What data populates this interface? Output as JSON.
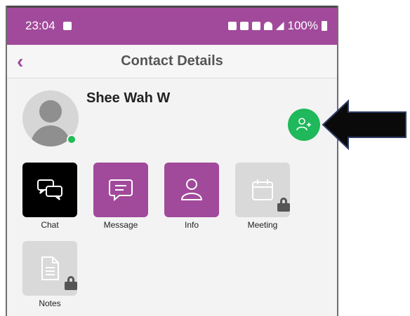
{
  "status_bar": {
    "time": "23:04",
    "battery": "100%",
    "icons": [
      "photo-icon",
      "nfc-icon",
      "vibrate-icon",
      "mute-icon",
      "wifi-icon",
      "signal-icon",
      "battery-icon"
    ]
  },
  "app_bar": {
    "title": "Contact Details",
    "back_icon": "chevron-left-icon"
  },
  "contact": {
    "name": "Shee Wah W",
    "presence": "online"
  },
  "actions": [
    {
      "label": "Chat",
      "enabled": true,
      "color": "#000000"
    },
    {
      "label": "Message",
      "enabled": true,
      "color": "#a14a9b"
    },
    {
      "label": "Info",
      "enabled": true,
      "color": "#a14a9b"
    },
    {
      "label": "Meeting",
      "enabled": false,
      "color": "#d9d9d9"
    },
    {
      "label": "Notes",
      "enabled": false,
      "color": "#d9d9d9"
    }
  ],
  "colors": {
    "brand": "#a14a9b",
    "add_button": "#1fb85a",
    "online": "#1ebd55"
  }
}
